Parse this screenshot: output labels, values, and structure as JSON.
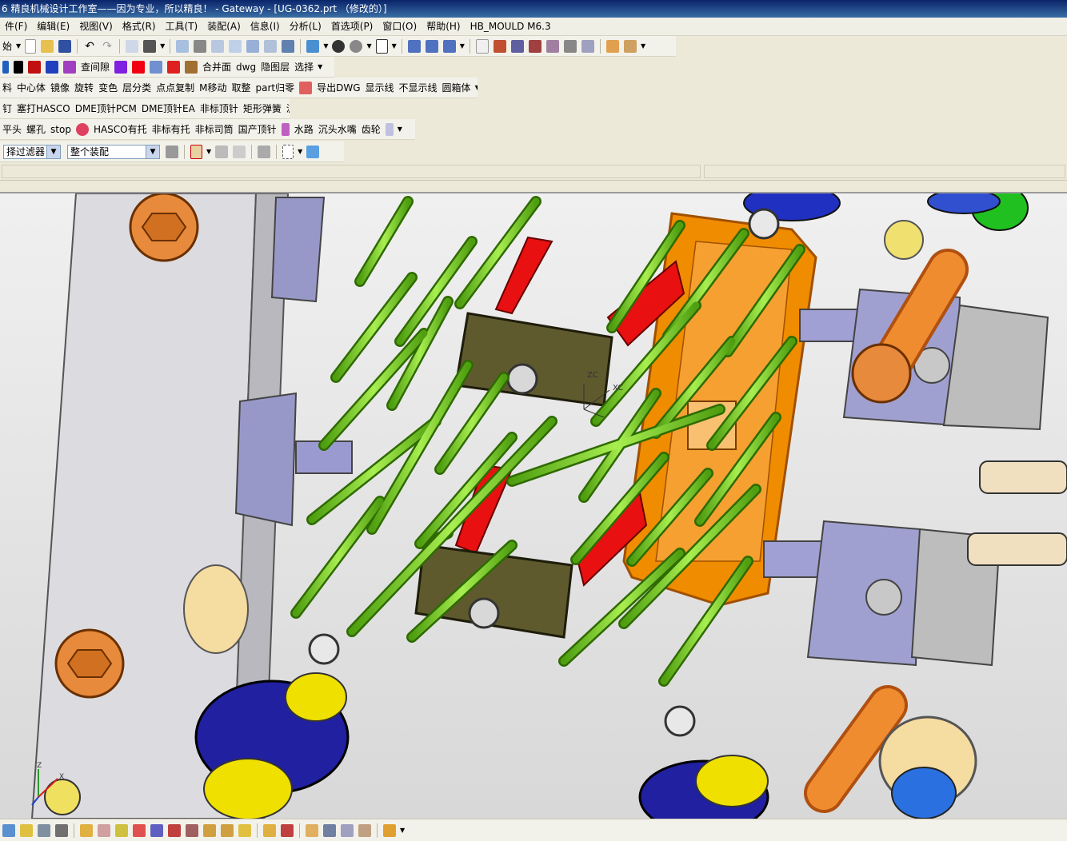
{
  "window": {
    "title": "6 精良机械设计工作室——因为专业，所以精良！ - Gateway - [UG-0362.prt （修改的）]"
  },
  "menu": [
    "件(F)",
    "编辑(E)",
    "视图(V)",
    "格式(R)",
    "工具(T)",
    "装配(A)",
    "信息(I)",
    "分析(L)",
    "首选项(P)",
    "窗口(O)",
    "帮助(H)",
    "HB_MOULD M6.3"
  ],
  "toolbar1": {
    "start_label": "始"
  },
  "toolbar2": {
    "items": [
      "查间隙",
      "合并面",
      "dwg",
      "隐图层",
      "选择"
    ]
  },
  "toolbar3": {
    "items": [
      "料",
      "中心体",
      "镜像",
      "旋转",
      "变色",
      "层分类",
      "点点复制",
      "M移动",
      "取整",
      "part归零",
      "导出DWG",
      "显示线",
      "不显示线",
      "圆箱体"
    ]
  },
  "toolbar4": {
    "items": [
      "钉",
      "塞打HASCO",
      "DME顶针PCM",
      "DME顶针EA",
      "非标顶针",
      "矩形弹簧",
      "派克"
    ]
  },
  "toolbar5": {
    "items": [
      "平头",
      "螺孔",
      "stop",
      "HASCO有托",
      "非标有托",
      "非标司筒",
      "国产顶针",
      "水路",
      "沉头水嘴",
      "齿轮"
    ]
  },
  "filter_bar": {
    "type_filter": "择过滤器",
    "scope": "整个装配"
  },
  "viewport": {
    "wcs_labels": [
      "ZC",
      "XC"
    ],
    "triad_labels": [
      "Z",
      "X"
    ]
  },
  "colors": {
    "title_bar": "#0a246a",
    "rod_green": "#7ed321",
    "cavity_orange": "#f08c00",
    "block_olive": "#5e5a2e",
    "slider_red": "#e81010",
    "plate_gray": "#d8d8dc",
    "block_lavender": "#9c9ccc",
    "bolt_orange": "#e88a3c",
    "spring_blue": "#2020a0",
    "cap_yellow": "#f0e000"
  }
}
